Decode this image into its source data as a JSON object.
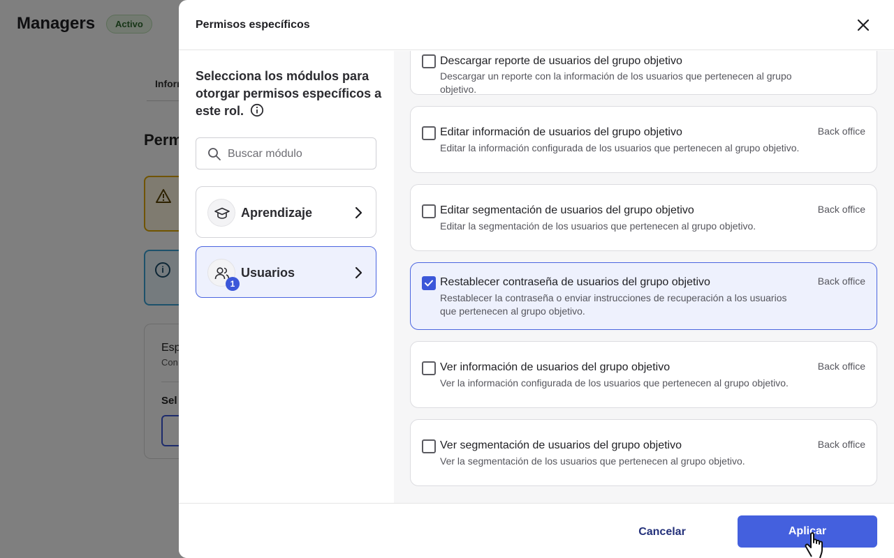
{
  "background": {
    "title": "Managers",
    "badge": "Activo",
    "tab_partial": "Inforr",
    "section_partial": "Perm",
    "card_text_1": "Esp",
    "card_text_2": "Con",
    "card_text_3": "Sel"
  },
  "modal": {
    "title": "Permisos específicos",
    "heading": "Selecciona los módulos para otorgar permisos específicos a este rol.",
    "search_placeholder": "Buscar módulo",
    "modules": [
      {
        "label": "Aprendizaje",
        "icon": "graduation-cap-icon",
        "selected": false,
        "count": ""
      },
      {
        "label": "Usuarios",
        "icon": "users-icon",
        "selected": true,
        "count": "1"
      }
    ],
    "permissions": [
      {
        "title": "Descargar reporte de usuarios del grupo objetivo",
        "desc": "Descargar un reporte con la información de los usuarios que pertenecen al grupo objetivo.",
        "tag": "",
        "checked": false
      },
      {
        "title": "Editar información de usuarios del grupo objetivo",
        "desc": "Editar la información configurada de los usuarios que pertenecen al grupo objetivo.",
        "tag": "Back office",
        "checked": false
      },
      {
        "title": "Editar segmentación de usuarios del grupo objetivo",
        "desc": "Editar la segmentación de los usuarios que pertenecen al grupo objetivo.",
        "tag": "Back office",
        "checked": false
      },
      {
        "title": "Restablecer contraseña de usuarios del grupo objetivo",
        "desc": "Restablecer la contraseña o enviar instrucciones de recuperación a los usuarios que pertenecen al grupo objetivo.",
        "tag": "Back office",
        "checked": true
      },
      {
        "title": "Ver información de usuarios del grupo objetivo",
        "desc": "Ver la información configurada de los usuarios que pertenecen al grupo objetivo.",
        "tag": "Back office",
        "checked": false
      },
      {
        "title": "Ver segmentación de usuarios del grupo objetivo",
        "desc": "Ver la segmentación de los usuarios que pertenecen al grupo objetivo.",
        "tag": "Back office",
        "checked": false
      }
    ],
    "cancel_label": "Cancelar",
    "apply_label": "Aplicar"
  },
  "colors": {
    "accent": "#4460de",
    "selected_bg": "#eef1fd",
    "overlay": "rgba(0,0,0,0.5)"
  }
}
